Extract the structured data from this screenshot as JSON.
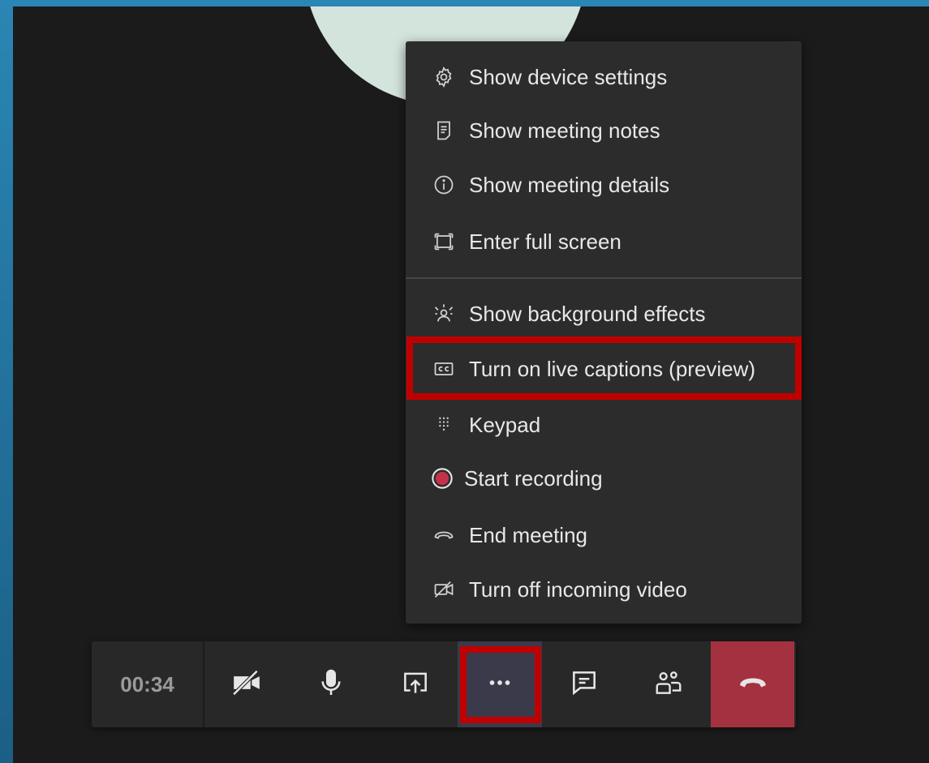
{
  "menu": {
    "items": [
      {
        "label": "Show device settings",
        "icon": "gear-icon"
      },
      {
        "label": "Show meeting notes",
        "icon": "notes-icon"
      },
      {
        "label": "Show meeting details",
        "icon": "info-icon"
      },
      {
        "label": "Enter full screen",
        "icon": "fullscreen-icon"
      },
      {
        "label": "Show background effects",
        "icon": "background-effects-icon"
      },
      {
        "label": "Turn on live captions (preview)",
        "icon": "captions-icon"
      },
      {
        "label": "Keypad",
        "icon": "keypad-icon"
      },
      {
        "label": "Start recording",
        "icon": "record-icon"
      },
      {
        "label": "End meeting",
        "icon": "end-call-icon"
      },
      {
        "label": "Turn off incoming video",
        "icon": "video-off-icon"
      }
    ]
  },
  "toolbar": {
    "timer": "00:34",
    "buttons": [
      {
        "name": "camera-toggle",
        "icon": "camera-off-icon"
      },
      {
        "name": "microphone-toggle",
        "icon": "microphone-icon"
      },
      {
        "name": "share-screen",
        "icon": "share-icon"
      },
      {
        "name": "more-actions",
        "icon": "more-icon",
        "active": true
      },
      {
        "name": "chat",
        "icon": "chat-icon"
      },
      {
        "name": "participants",
        "icon": "people-icon"
      },
      {
        "name": "hang-up",
        "icon": "hang-up-icon"
      }
    ]
  },
  "colors": {
    "highlight": "#c00000",
    "hangup": "#a4313f",
    "record": "#c4314b",
    "menu_bg": "#2d2c2c",
    "stage_bg": "#1b1b1b"
  }
}
